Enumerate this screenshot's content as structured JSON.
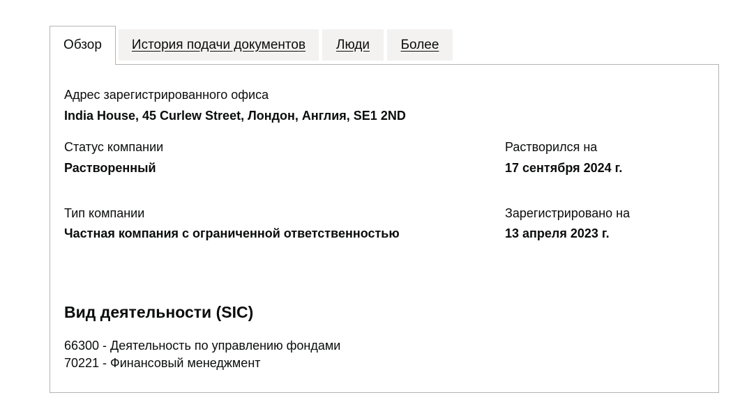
{
  "tabs": [
    {
      "label": "Обзор",
      "active": true
    },
    {
      "label": "История подачи документов",
      "active": false
    },
    {
      "label": "Люди",
      "active": false
    },
    {
      "label": "Более",
      "active": false
    }
  ],
  "overview": {
    "registered_office": {
      "label": "Адрес зарегистрированного офиса",
      "value": "India House, 45 Curlew Street, Лондон, Англия, SE1 2ND"
    },
    "company_status": {
      "label": "Статус компании",
      "value": "Растворенный"
    },
    "dissolved_on": {
      "label": "Растворился на",
      "value": "17 сентября 2024 г."
    },
    "company_type": {
      "label": "Тип компании",
      "value": "Частная компания с ограниченной ответственностью"
    },
    "incorporated_on": {
      "label": "Зарегистрировано на",
      "value": "13 апреля 2023 г."
    }
  },
  "sic": {
    "heading": "Вид деятельности (SIC)",
    "items": [
      "66300 - Деятельность по управлению фондами",
      "70221 - Финансовый менеджмент"
    ]
  }
}
